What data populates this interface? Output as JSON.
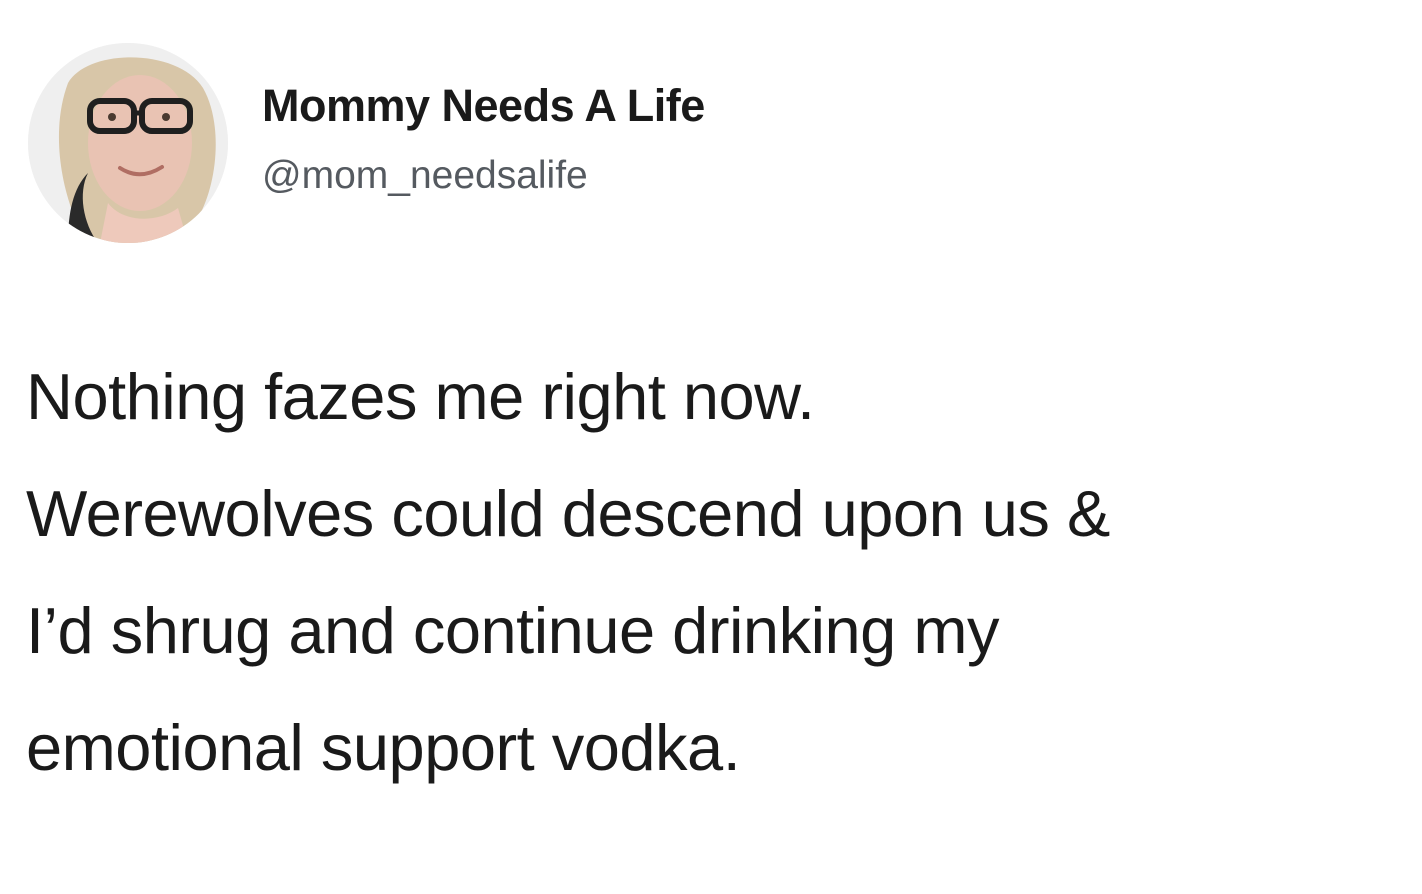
{
  "author": {
    "display_name": "Mommy Needs A Life",
    "handle": "@mom_needsalife",
    "avatar_icon": "user-avatar-photo"
  },
  "tweet": {
    "lines": [
      "Nothing fazes me right now.",
      "Werewolves could descend upon us &",
      "I’d shrug and continue drinking my",
      "emotional support vodka."
    ]
  },
  "colors": {
    "background": "#ffffff",
    "text": "#1a1a1a",
    "handle": "#555a60"
  }
}
